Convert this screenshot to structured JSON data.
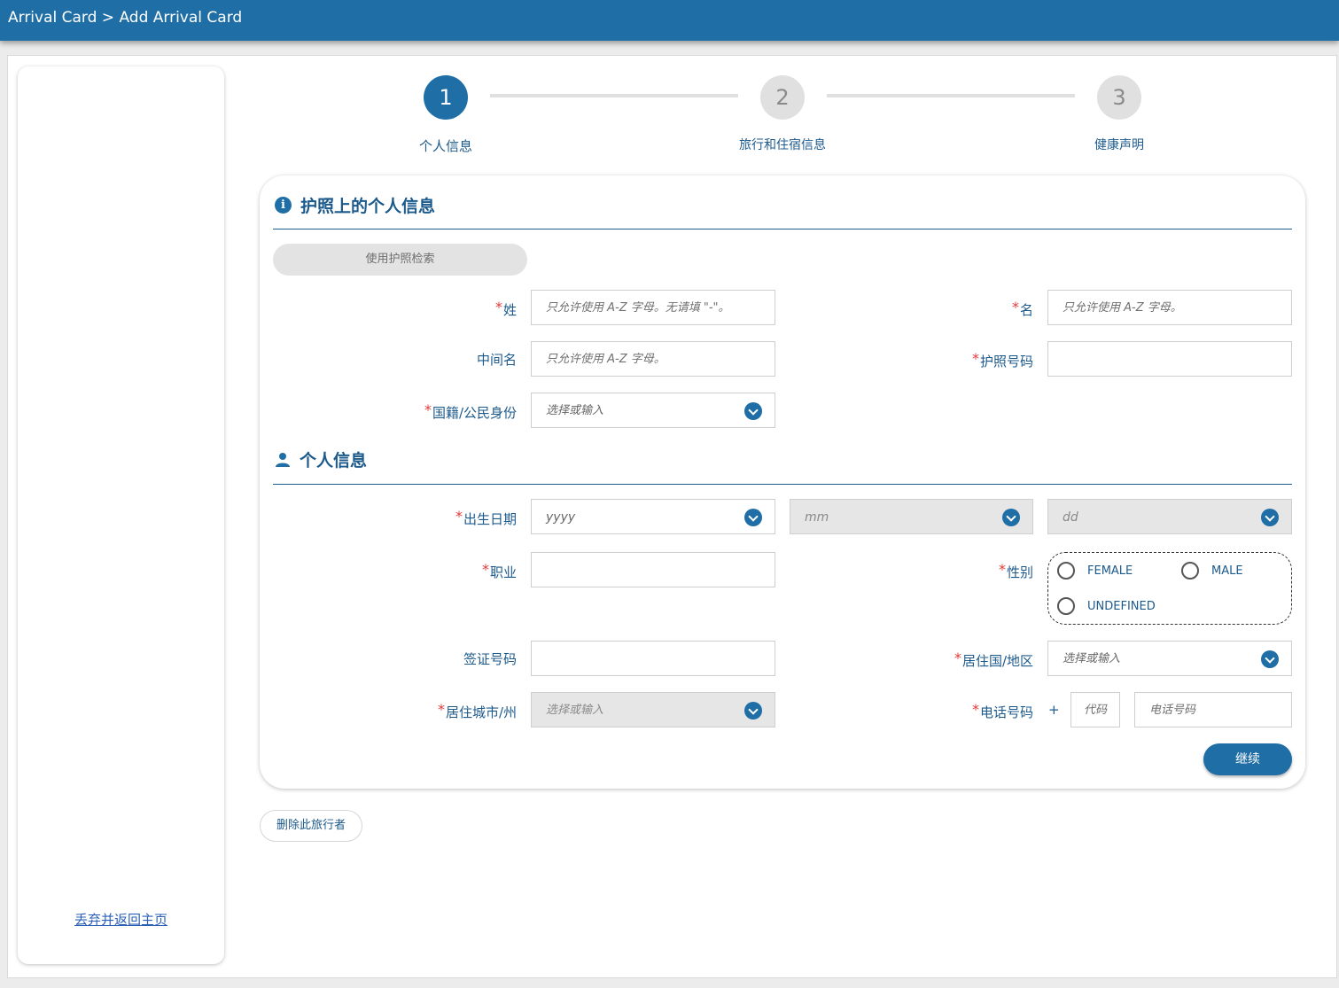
{
  "header": {
    "breadcrumb": "Arrival Card > Add Arrival Card"
  },
  "stepper": {
    "steps": [
      {
        "number": "1",
        "label": "个人信息",
        "state": "active"
      },
      {
        "number": "2",
        "label": "旅行和住宿信息",
        "state": "inactive"
      },
      {
        "number": "3",
        "label": "健康声明",
        "state": "inactive"
      }
    ]
  },
  "passport_section": {
    "title": "护照上的个人信息",
    "icon": "info-icon",
    "retrieve_button": "使用护照检索",
    "surname": {
      "label": "姓",
      "placeholder": "只允许使用 A-Z 字母。无请填 \"-\"。"
    },
    "given_name": {
      "label": "名",
      "placeholder": "只允许使用 A-Z 字母。"
    },
    "middle_name": {
      "label": "中间名",
      "placeholder": "只允许使用 A-Z 字母。"
    },
    "passport_number": {
      "label": "护照号码",
      "placeholder": ""
    },
    "nationality": {
      "label": "国籍/公民身份",
      "placeholder": "选择或输入"
    }
  },
  "personal_section": {
    "title": "个人信息",
    "icon": "person-icon",
    "dob": {
      "label": "出生日期",
      "year": "yyyy",
      "month": "mm",
      "day": "dd"
    },
    "occupation": {
      "label": "职业",
      "placeholder": ""
    },
    "gender": {
      "label": "性别",
      "options": [
        "FEMALE",
        "MALE",
        "UNDEFINED"
      ]
    },
    "visa_number": {
      "label": "签证号码",
      "placeholder": ""
    },
    "residence_country": {
      "label": "居住国/地区",
      "placeholder": "选择或输入"
    },
    "residence_city": {
      "label": "居住城市/州",
      "placeholder": "选择或输入"
    },
    "phone": {
      "label": "电话号码",
      "plus": "+",
      "code_placeholder": "代码",
      "number_placeholder": "电话号码"
    }
  },
  "actions": {
    "continue": "继续",
    "delete_traveler": "删除此旅行者"
  },
  "sidebar": {
    "discard_link": "丢弃并返回主页"
  },
  "colors": {
    "primary": "#1f6ea6",
    "required": "#e23a3a"
  }
}
